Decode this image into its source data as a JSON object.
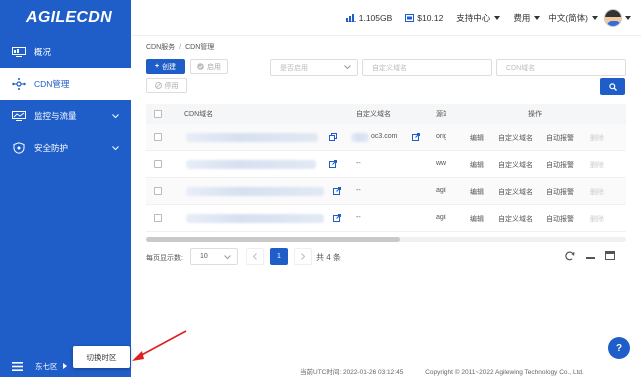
{
  "app": {
    "logo": "AGILECDN"
  },
  "sidebar": {
    "items": [
      {
        "label": "概况",
        "icon": "monitor-icon"
      },
      {
        "label": "CDN管理",
        "icon": "network-icon",
        "active": true
      },
      {
        "label": "监控与流量",
        "icon": "monitor-chart-icon",
        "expandable": true
      },
      {
        "label": "安全防护",
        "icon": "shield-icon",
        "expandable": true
      }
    ],
    "region_label": "东七区",
    "switch_tz_label": "切换时区"
  },
  "header": {
    "usage": "1.105GB",
    "balance": "$10.12",
    "support": "支持中心",
    "billing": "费用",
    "language": "中文(简体)"
  },
  "breadcrumb": {
    "root": "CDN服务",
    "sep": "/",
    "current": "CDN管理"
  },
  "toolbar": {
    "create": "创建",
    "enable": "启用",
    "disable": "停用",
    "status_placeholder": "是否启用",
    "custom_domain_placeholder": "自定义域名",
    "cdn_domain_placeholder": "CDN域名"
  },
  "table": {
    "columns": {
      "cdn_domain": "CDN域名",
      "custom_domain": "自定义域名",
      "origin": "源站",
      "actions": "操作"
    },
    "rows": [
      {
        "custom_domain": "oc3.com",
        "origin": "orig"
      },
      {
        "custom_domain": "--",
        "origin": "www"
      },
      {
        "custom_domain": "--",
        "origin": "agil"
      },
      {
        "custom_domain": "--",
        "origin": "agil"
      }
    ],
    "row_actions": {
      "edit": "编辑",
      "custom": "自定义域名",
      "alert": "自动报警",
      "delete": "删除"
    }
  },
  "pagination": {
    "page_size_label": "每页显示数:",
    "page_size": "10",
    "current_page": "1",
    "total": "共 4 条"
  },
  "footer": {
    "time": "当前UTC时间: 2022-01-26 03:12:45",
    "copyright": "Copyright © 2011~2022 Agilewing Technology Co., Ltd."
  },
  "colors": {
    "primary": "#1f5ec9",
    "arrow": "#e02020"
  }
}
